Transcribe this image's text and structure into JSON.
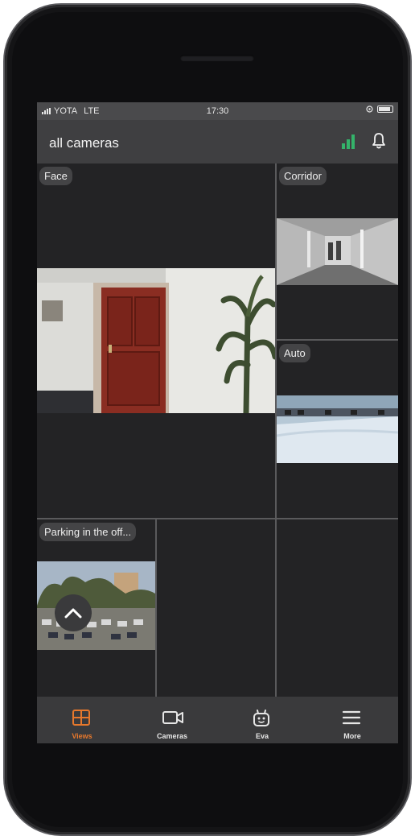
{
  "status_bar": {
    "carrier": "YOTA",
    "network": "LTE",
    "time": "17:30"
  },
  "header": {
    "title": "all cameras"
  },
  "colors": {
    "accent": "#e7782c",
    "signal": "#34b36a"
  },
  "cameras": [
    {
      "label": "Face"
    },
    {
      "label": "Corridor"
    },
    {
      "label": "Auto"
    },
    {
      "label": "Parking in the off..."
    }
  ],
  "tabs": [
    {
      "label": "Views",
      "icon": "grid-icon",
      "active": true
    },
    {
      "label": "Cameras",
      "icon": "video-camera-icon",
      "active": false
    },
    {
      "label": "Eva",
      "icon": "robot-icon",
      "active": false
    },
    {
      "label": "More",
      "icon": "menu-icon",
      "active": false
    }
  ]
}
